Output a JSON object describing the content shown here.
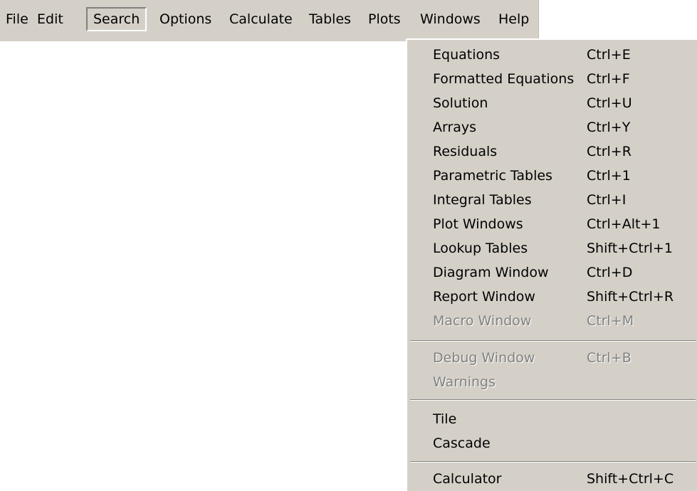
{
  "menubar": {
    "items": [
      {
        "label": "File"
      },
      {
        "label": "Edit"
      },
      {
        "label": "Search"
      },
      {
        "label": "Options"
      },
      {
        "label": "Calculate"
      },
      {
        "label": "Tables"
      },
      {
        "label": "Plots"
      },
      {
        "label": "Windows"
      },
      {
        "label": "Help"
      }
    ],
    "active": "Search"
  },
  "windows_menu": {
    "items": [
      {
        "label": "Equations",
        "shortcut": "Ctrl+E",
        "enabled": true
      },
      {
        "label": "Formatted Equations",
        "shortcut": "Ctrl+F",
        "enabled": true
      },
      {
        "label": "Solution",
        "shortcut": "Ctrl+U",
        "enabled": true
      },
      {
        "label": "Arrays",
        "shortcut": "Ctrl+Y",
        "enabled": true
      },
      {
        "label": "Residuals",
        "shortcut": "Ctrl+R",
        "enabled": true
      },
      {
        "label": "Parametric Tables",
        "shortcut": "Ctrl+1",
        "enabled": true
      },
      {
        "label": "Integral Tables",
        "shortcut": "Ctrl+I",
        "enabled": true
      },
      {
        "label": "Plot Windows",
        "shortcut": "Ctrl+Alt+1",
        "enabled": true
      },
      {
        "label": "Lookup Tables",
        "shortcut": "Shift+Ctrl+1",
        "enabled": true
      },
      {
        "label": "Diagram Window",
        "shortcut": "Ctrl+D",
        "enabled": true
      },
      {
        "label": "Report Window",
        "shortcut": "Shift+Ctrl+R",
        "enabled": true
      },
      {
        "label": "Macro Window",
        "shortcut": "Ctrl+M",
        "enabled": false
      },
      {
        "label": "Debug Window",
        "shortcut": "Ctrl+B",
        "enabled": false
      },
      {
        "label": "Warnings",
        "shortcut": "",
        "enabled": false
      },
      {
        "label": "Tile",
        "shortcut": "",
        "enabled": true
      },
      {
        "label": "Cascade",
        "shortcut": "",
        "enabled": true
      },
      {
        "label": "Calculator",
        "shortcut": "Shift+Ctrl+C",
        "enabled": true
      }
    ]
  },
  "colors": {
    "menu_background": "#d4d0c8",
    "disabled_text": "#808080"
  }
}
